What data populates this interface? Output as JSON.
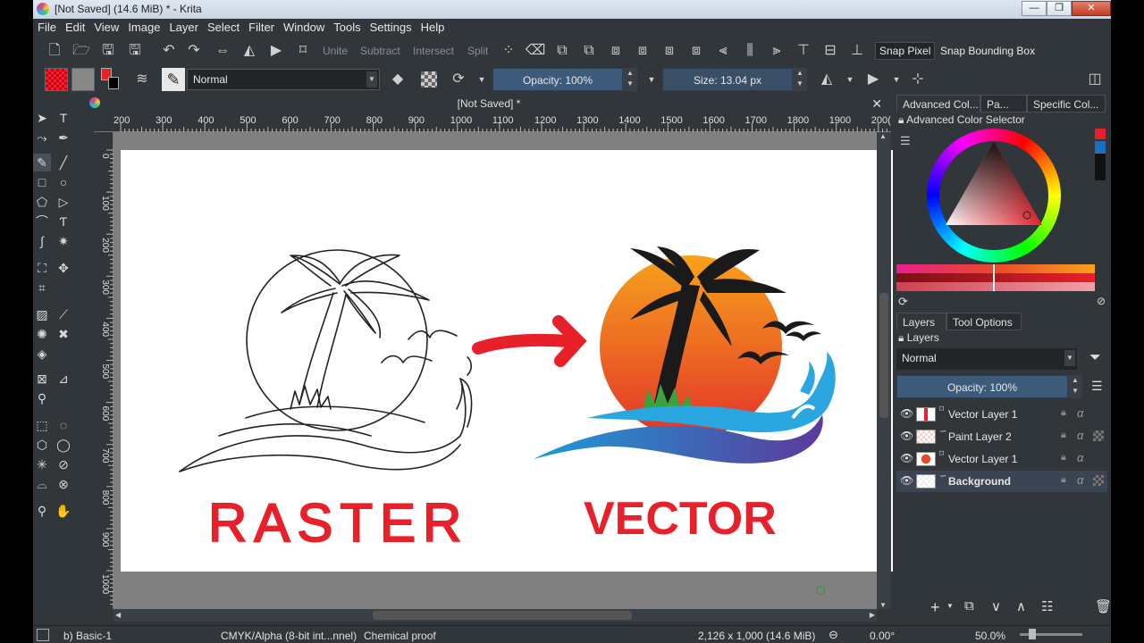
{
  "window": {
    "title": "[Not Saved]  (14.6 MiB)  * - Krita",
    "controls": {
      "minimize": "—",
      "maximize": "❐",
      "close": "✕"
    }
  },
  "menu": [
    "File",
    "Edit",
    "View",
    "Image",
    "Layer",
    "Select",
    "Filter",
    "Window",
    "Tools",
    "Settings",
    "Help"
  ],
  "toolbar": {
    "boolean_ops": [
      "Unite",
      "Subtract",
      "Intersect",
      "Split"
    ],
    "snap_pixel": "Snap Pixel",
    "snap_bounding_box": "Snap Bounding Box",
    "blend_mode": "Normal",
    "opacity": "Opacity: 100%",
    "size": "Size: 13.04 px",
    "foreground_color": "#e8202a",
    "background_color": "#000000"
  },
  "document": {
    "tab_title": "[Not Saved]  *",
    "close": "✕",
    "ruler_h": [
      "200",
      "300",
      "400",
      "500",
      "600",
      "700",
      "800",
      "900",
      "1000",
      "1100",
      "1200",
      "1300",
      "1400",
      "1500",
      "1600",
      "1700",
      "1800",
      "1900",
      "200("
    ],
    "ruler_v": [
      "0",
      "100",
      "200",
      "300",
      "400",
      "500",
      "600",
      "700",
      "800",
      "900",
      "1000"
    ],
    "artwork": {
      "left_label": "RASTER",
      "right_label": "VECTOR",
      "accent_red": "#e8202a",
      "sun_top": "#f7a21b",
      "sun_bottom": "#e3342a",
      "wave_blue": "#1d9bd7",
      "wave_purple": "#5b3a9a"
    }
  },
  "dockers": {
    "color_tabs": [
      "Advanced Col...",
      "Pa...",
      "Specific Col..."
    ],
    "color_selector_title": "Advanced Color Selector",
    "layer_tabs": [
      "Layers",
      "Tool Options"
    ],
    "layers_title": "Layers",
    "layers_blend_mode": "Normal",
    "layers_opacity": "Opacity:  100%",
    "layers": [
      {
        "name": "Vector Layer 1",
        "type": "vector",
        "selected": false
      },
      {
        "name": "Paint Layer 2",
        "type": "paint",
        "selected": false
      },
      {
        "name": "Vector Layer 1",
        "type": "vector",
        "selected": false
      },
      {
        "name": "Background",
        "type": "paint",
        "selected": true
      }
    ]
  },
  "status": {
    "brush": "b) Basic-1",
    "color_space": "CMYK/Alpha (8-bit int...nnel)",
    "proof": "Chemical proof",
    "dimensions": "2,126 x 1,000 (14.6 MiB)",
    "rotation": "0.00°",
    "zoom": "50.0%"
  }
}
